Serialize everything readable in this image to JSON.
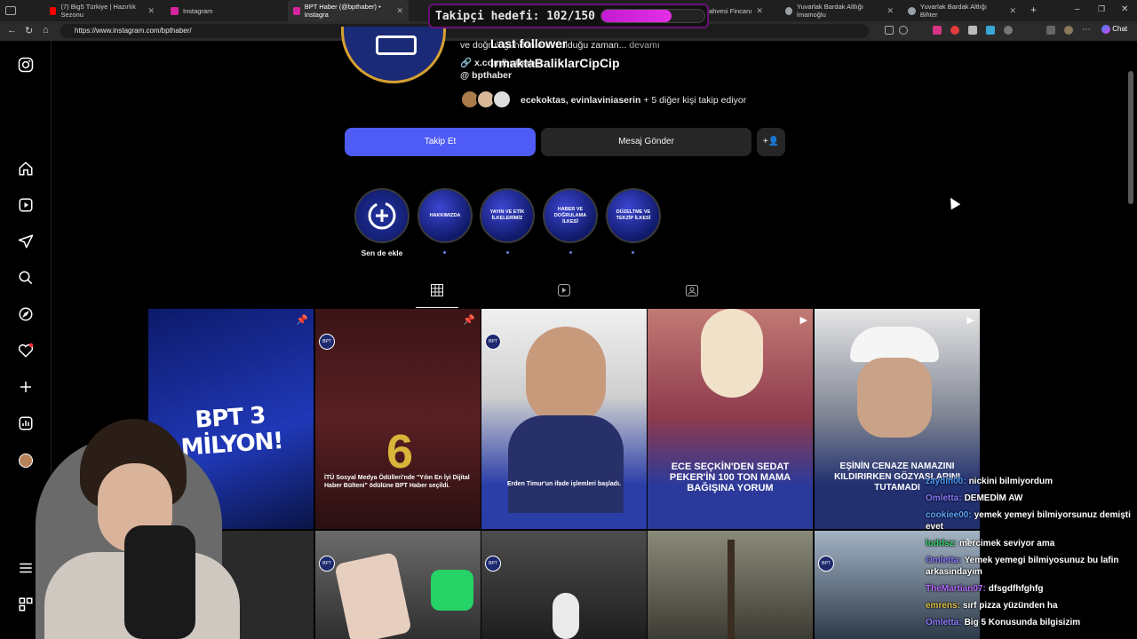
{
  "browser": {
    "tabs": [
      {
        "title": "(7) Big5 Türkiye | Hazırlık Sezonu",
        "color": "#ff0000"
      },
      {
        "title": "Instagram",
        "color": "#d6249f"
      },
      {
        "title": "BPT Haber (@bpthaber) • Instagra",
        "color": "#d6249f"
      },
      {
        "title": "ahvesi Fincanı",
        "color": "#9aa0a6"
      },
      {
        "title": "Yuvarlak Bardak Altlığı İmamoğlu",
        "color": "#9aa0a6"
      },
      {
        "title": "Yuvarlak Bardak Altlığı Bihter",
        "color": "#9aa0a6"
      }
    ],
    "url": "https://www.instagram.com/bpthaber/",
    "chat_button": "Chat"
  },
  "overlay": {
    "goal_label": "Takipçi hedefi: 102/150",
    "goal_progress": 0.68,
    "last_follower_label": "Last follower",
    "last_follower_name": "IrmaktaBaliklarCipCip"
  },
  "profile": {
    "bio_line": "ve doğruluğundan emin olduğu zaman...",
    "more": "devamı",
    "link": "x.com/bpthaber",
    "threads": "bpthaber",
    "followed_by_names": "ecekoktas, evinlaviniaserin",
    "followed_by_more": " + 5 diğer kişi takip ediyor",
    "follow_button": "Takip Et",
    "message_button": "Mesaj Gönder"
  },
  "highlights": [
    {
      "label": "Sen de ekle",
      "text": ""
    },
    {
      "label": "",
      "text": "HAKKIMIZDA"
    },
    {
      "label": "",
      "text": "YAYIN VE ETİK İLKELERİMİZ"
    },
    {
      "label": "",
      "text": "HABER VE DOĞRULAMA İLKESİ"
    },
    {
      "label": "",
      "text": "DÜZELTME VE TEKZİP İLKESİ"
    }
  ],
  "posts": [
    {
      "caption": "BPT 3 MİLYON!",
      "bg": "#1a2b8a"
    },
    {
      "caption": "İTÜ Sosyal Medya Ödülleri'nde \"Yılın En İyi Dijital Haber Bülteni\" ödülüne BPT Haber seçildi.",
      "bg": "#5a1f22"
    },
    {
      "caption": "Erden Timur'un ifade işlemleri başladı.",
      "bg": "#2b3ea8"
    },
    {
      "caption": "ECE SEÇKİN'DEN SEDAT PEKER'İN 100 TON MAMA BAĞIŞINA YORUM",
      "bg": "#6a2a4a"
    },
    {
      "caption": "EŞİNİN CENAZE NAMAZINI KILDIRIRKEN GÖZYAŞLARINI TUTAMADI",
      "bg": "#2a3a7a"
    }
  ],
  "chat": [
    {
      "user": "zaydin00:",
      "msg": "nickini bilmiyordum",
      "color": "#4a9bff"
    },
    {
      "user": "Omletta:",
      "msg": "DEMEDİM AW",
      "color": "#8a7bff"
    },
    {
      "user": "cookiee00:",
      "msg": "yemek yemeyi bilmiyorsunuz demişti evet",
      "color": "#5aa7ff"
    },
    {
      "user": "luddsz:",
      "msg": "mercimek seviyor ama",
      "color": "#3bd16f"
    },
    {
      "user": "Omletta:",
      "msg": "Yemek yemegi bilmiyosunuz bu lafin arkasindayim",
      "color": "#8a7bff"
    },
    {
      "user": "TheMartian07:",
      "msg": "dfsgdfhfghfg",
      "color": "#b56bff"
    },
    {
      "user": "emrens:",
      "msg": "sırf pizza yüzünden ha",
      "color": "#e0c04a"
    },
    {
      "user": "Omletta:",
      "msg": "Big 5 Konusunda bilgisizim",
      "color": "#8a7bff"
    }
  ]
}
